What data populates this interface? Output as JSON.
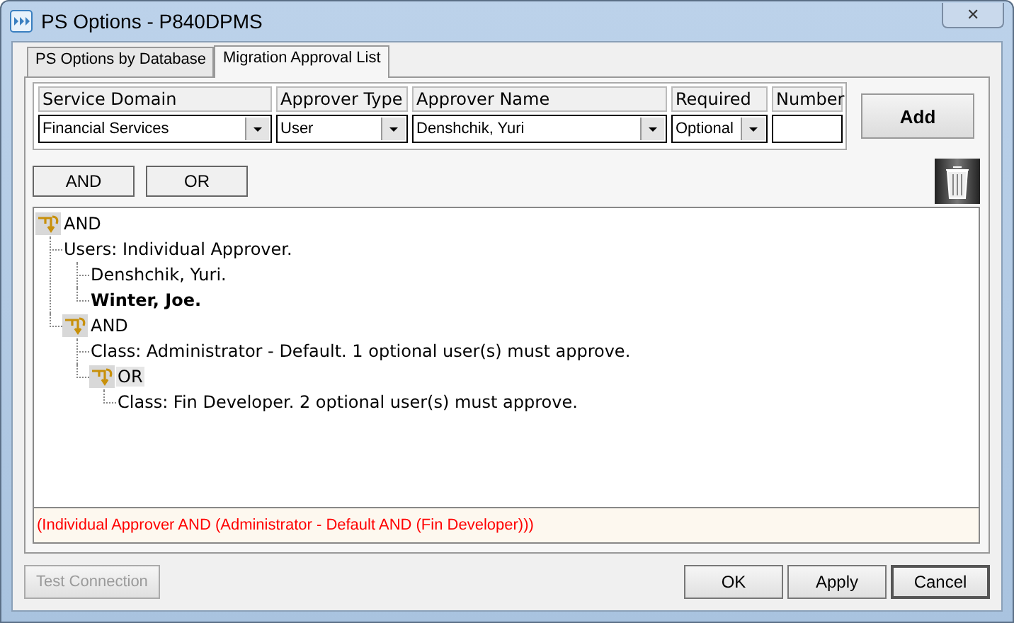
{
  "window": {
    "title": "PS Options - P840DPMS",
    "close": "✕"
  },
  "tabs": [
    {
      "label": "PS Options by Database",
      "selected": false
    },
    {
      "label": "Migration Approval List",
      "selected": true
    }
  ],
  "form": {
    "columns": [
      "Service Domain",
      "Approver Type",
      "Approver Name",
      "Required",
      "Number"
    ],
    "fields": [
      {
        "kind": "dropdown",
        "value": "Financial Services"
      },
      {
        "kind": "dropdown",
        "value": "User"
      },
      {
        "kind": "dropdown",
        "value": "Denshchik, Yuri"
      },
      {
        "kind": "dropdown",
        "value": "Optional"
      },
      {
        "kind": "text"
      }
    ],
    "add_button": "Add"
  },
  "logic_buttons": [
    "AND",
    "OR"
  ],
  "tree": [
    {
      "kind": "group",
      "label": "AND",
      "bold": false,
      "selected": false,
      "children": [
        {
          "kind": "item",
          "label": "Users: Individual Approver.",
          "bold": false,
          "selected": false,
          "children": [
            {
              "kind": "item",
              "label": "Denshchik, Yuri.",
              "bold": false,
              "selected": false
            },
            {
              "kind": "item",
              "label": "Winter, Joe.",
              "bold": true,
              "selected": false
            }
          ]
        },
        {
          "kind": "group",
          "label": "AND",
          "bold": false,
          "selected": false,
          "children": [
            {
              "kind": "item",
              "label": "Class: Administrator - Default. 1 optional user(s) must approve.",
              "bold": false,
              "selected": false
            },
            {
              "kind": "group",
              "label": "OR",
              "bold": false,
              "selected": true,
              "children": [
                {
                  "kind": "item",
                  "label": "Class: Fin Developer. 2 optional user(s) must approve.",
                  "bold": false,
                  "selected": false
                }
              ]
            }
          ]
        }
      ]
    }
  ],
  "expression": "(Individual Approver AND (Administrator - Default AND (Fin Developer)))",
  "footer": {
    "test_button": {
      "label": "Test Connection",
      "disabled": true
    },
    "buttons": [
      "OK",
      "Apply",
      "Cancel"
    ]
  }
}
